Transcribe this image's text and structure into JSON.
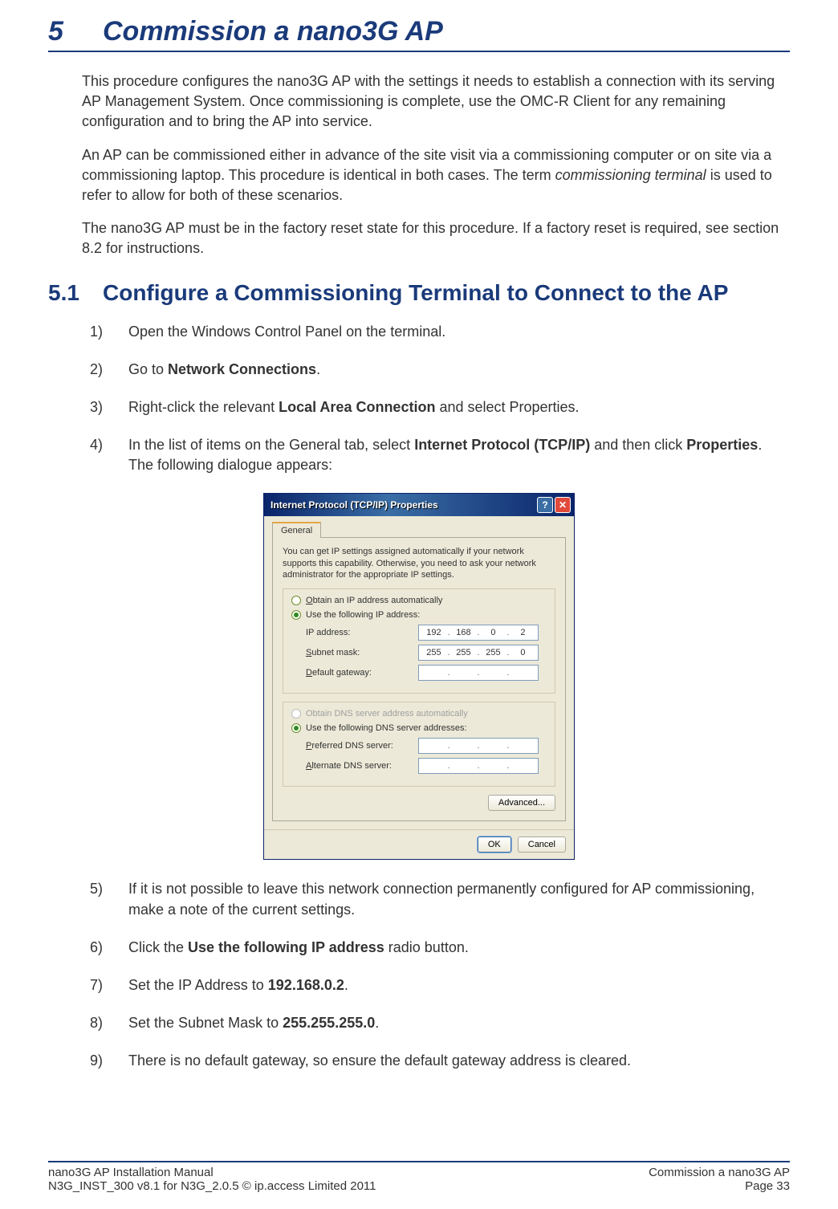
{
  "chapter": {
    "num": "5",
    "title": "Commission a nano3G AP"
  },
  "intro": {
    "p1": "This procedure configures the nano3G AP with the settings it needs to establish a connection with its serving AP Management System. Once commissioning is complete, use the OMC-R Client for any remaining configuration and to bring the AP into service.",
    "p2a": "An AP can be commissioned either in advance of the site visit via a commissioning computer or on site via a commissioning laptop. This procedure is identical in both cases. The term ",
    "p2_em": "commissioning terminal",
    "p2b": " is used to refer to allow for both of these scenarios.",
    "p3": "The nano3G AP must be in the factory reset state for this procedure. If a factory reset is required, see section 8.2 for instructions."
  },
  "section": {
    "num": "5.1",
    "title": "Configure a Commissioning Terminal to Connect to the AP"
  },
  "steps": {
    "s1": {
      "n": "1)",
      "t": "Open the Windows Control Panel on the terminal."
    },
    "s2": {
      "n": "2)",
      "pre": "Go to ",
      "b": "Network Connections",
      "post": "."
    },
    "s3": {
      "n": "3)",
      "pre": "Right-click the relevant ",
      "b": "Local Area Connection",
      "post": " and select Properties."
    },
    "s4": {
      "n": "4)",
      "pre": "In the list of items on the General tab, select ",
      "b1": "Internet Protocol (TCP/IP)",
      "mid": " and then click ",
      "b2": "Properties",
      "post": ". The following dialogue appears:"
    },
    "s5": {
      "n": "5)",
      "t": "If it is not possible to leave this network connection permanently configured for AP commissioning, make a note of the current settings."
    },
    "s6": {
      "n": "6)",
      "pre": "Click the ",
      "b": "Use the following IP address",
      "post": " radio button."
    },
    "s7": {
      "n": "7)",
      "pre": "Set the IP Address to ",
      "b": "192.168.0.2",
      "post": "."
    },
    "s8": {
      "n": "8)",
      "pre": "Set the Subnet Mask to ",
      "b": "255.255.255.0",
      "post": "."
    },
    "s9": {
      "n": "9)",
      "t": "There is no default gateway, so ensure the default gateway address is cleared."
    }
  },
  "dialog": {
    "title": "Internet Protocol (TCP/IP) Properties",
    "tab": "General",
    "desc": "You can get IP settings assigned automatically if your network supports this capability. Otherwise, you need to ask your network administrator for the appropriate IP settings.",
    "radio_auto_ip": "Obtain an IP address automatically",
    "radio_use_ip": "Use the following IP address:",
    "lbl_ip": "IP address:",
    "lbl_subnet": "Subnet mask:",
    "lbl_gw": "Default gateway:",
    "ip": {
      "a": "192",
      "b": "168",
      "c": "0",
      "d": "2"
    },
    "subnet": {
      "a": "255",
      "b": "255",
      "c": "255",
      "d": "0"
    },
    "radio_auto_dns": "Obtain DNS server address automatically",
    "radio_use_dns": "Use the following DNS server addresses:",
    "lbl_pref_dns": "Preferred DNS server:",
    "lbl_alt_dns": "Alternate DNS server:",
    "btn_advanced": "Advanced...",
    "btn_ok": "OK",
    "btn_cancel": "Cancel"
  },
  "footer": {
    "left1": "nano3G AP Installation Manual",
    "left2": "N3G_INST_300 v8.1 for N3G_2.0.5 © ip.access Limited 2011",
    "right1": "Commission a nano3G AP",
    "right2": "Page 33"
  }
}
